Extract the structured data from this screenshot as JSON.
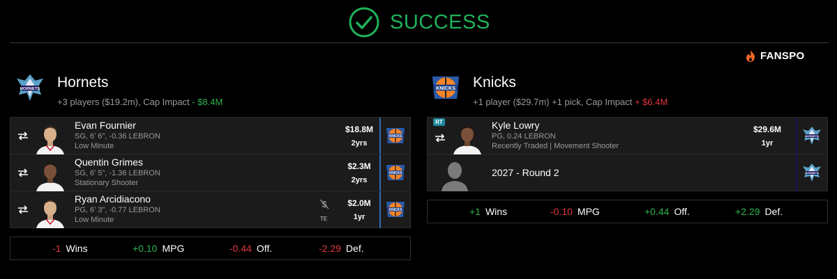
{
  "banner": {
    "status": "SUCCESS",
    "icon": "check-circle-icon",
    "color": "#1fb25a"
  },
  "brand": {
    "name": "FANSPO",
    "icon": "flame-icon"
  },
  "teams": [
    {
      "name": "Hornets",
      "logo": "hornets-logo-icon",
      "summary_prefix": "+3 players ($19.2m), Cap Impact",
      "cap_impact": "- $8.4M",
      "players": [
        {
          "name": "Evan Fournier",
          "info": "SG, 6' 6\", -0.36 LEBRON",
          "note": "Low Minute",
          "salary": "$18.8M",
          "years": "2yrs",
          "destination": "knicks-logo-icon"
        },
        {
          "name": "Quentin Grimes",
          "info": "SG, 6' 5\", -1.36 LEBRON",
          "note": "Stationary Shooter",
          "salary": "$2.3M",
          "years": "2yrs",
          "destination": "knicks-logo-icon"
        },
        {
          "name": "Ryan Arcidiacono",
          "info": "PG, 6' 3\", -0.77 LEBRON",
          "note": "Low Minute",
          "salary": "$2.0M",
          "years": "1yr",
          "badge": "TE",
          "destination": "knicks-logo-icon"
        }
      ],
      "stats": [
        {
          "value": "-1",
          "label": "Wins",
          "tone": "neg"
        },
        {
          "value": "+0.10",
          "label": "MPG",
          "tone": "pos"
        },
        {
          "value": "-0.44",
          "label": "Off.",
          "tone": "neg"
        },
        {
          "value": "-2.29",
          "label": "Def.",
          "tone": "neg"
        }
      ]
    },
    {
      "name": "Knicks",
      "logo": "knicks-logo-icon",
      "summary_prefix": "+1 player ($29.7m) +1 pick, Cap Impact",
      "cap_impact": "+ $6.4M",
      "players": [
        {
          "name": "Kyle Lowry",
          "info": "PG, 0.24 LEBRON",
          "note": "Recently Traded | Movement Shooter",
          "salary": "$29.6M",
          "years": "1yr",
          "badge": "RT",
          "destination": "hornets-logo-icon"
        }
      ],
      "picks": [
        {
          "label": "2027 - Round 2",
          "destination": "hornets-logo-icon"
        }
      ],
      "stats": [
        {
          "value": "+1",
          "label": "Wins",
          "tone": "pos"
        },
        {
          "value": "-0.10",
          "label": "MPG",
          "tone": "neg"
        },
        {
          "value": "+0.44",
          "label": "Off.",
          "tone": "pos"
        },
        {
          "value": "+2.29",
          "label": "Def.",
          "tone": "pos"
        }
      ]
    }
  ],
  "colors": {
    "positive": "#2fb14f",
    "negative": "#e0383e",
    "knicks_bar": "#2a6db5",
    "hornets_bar": "#1d1160"
  }
}
